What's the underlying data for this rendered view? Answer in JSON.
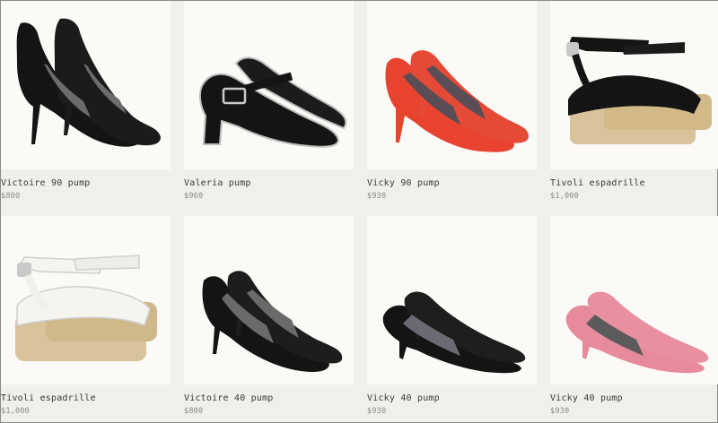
{
  "products": [
    {
      "name": "Victoire 90 pump",
      "price": "$800",
      "icon": "black-suede-wing-pump-icon"
    },
    {
      "name": "Valeria pump",
      "price": "$960",
      "icon": "black-mary-jane-pump-icon"
    },
    {
      "name": "Vicky 90 pump",
      "price": "$930",
      "icon": "red-suede-pump-icon"
    },
    {
      "name": "Tivoli espadrille",
      "price": "$1,000",
      "icon": "black-espadrille-wedge-icon"
    },
    {
      "name": "Tivoli espadrille",
      "price": "$1,000",
      "icon": "white-espadrille-wedge-icon"
    },
    {
      "name": "Victoire 40 pump",
      "price": "$800",
      "icon": "black-suede-wing-kitten-pump-icon"
    },
    {
      "name": "Vicky 40 pump",
      "price": "$930",
      "icon": "black-leather-kitten-pump-icon"
    },
    {
      "name": "Vicky 40 pump",
      "price": "$930",
      "icon": "pink-suede-kitten-pump-icon"
    }
  ],
  "colors": {
    "card_bg": "#fbfaf6",
    "page_bg": "#f1efe9",
    "red_suede": "#e8432f",
    "pink_suede": "#e58b9b",
    "black": "#141414",
    "jute": "#d8c39b"
  }
}
